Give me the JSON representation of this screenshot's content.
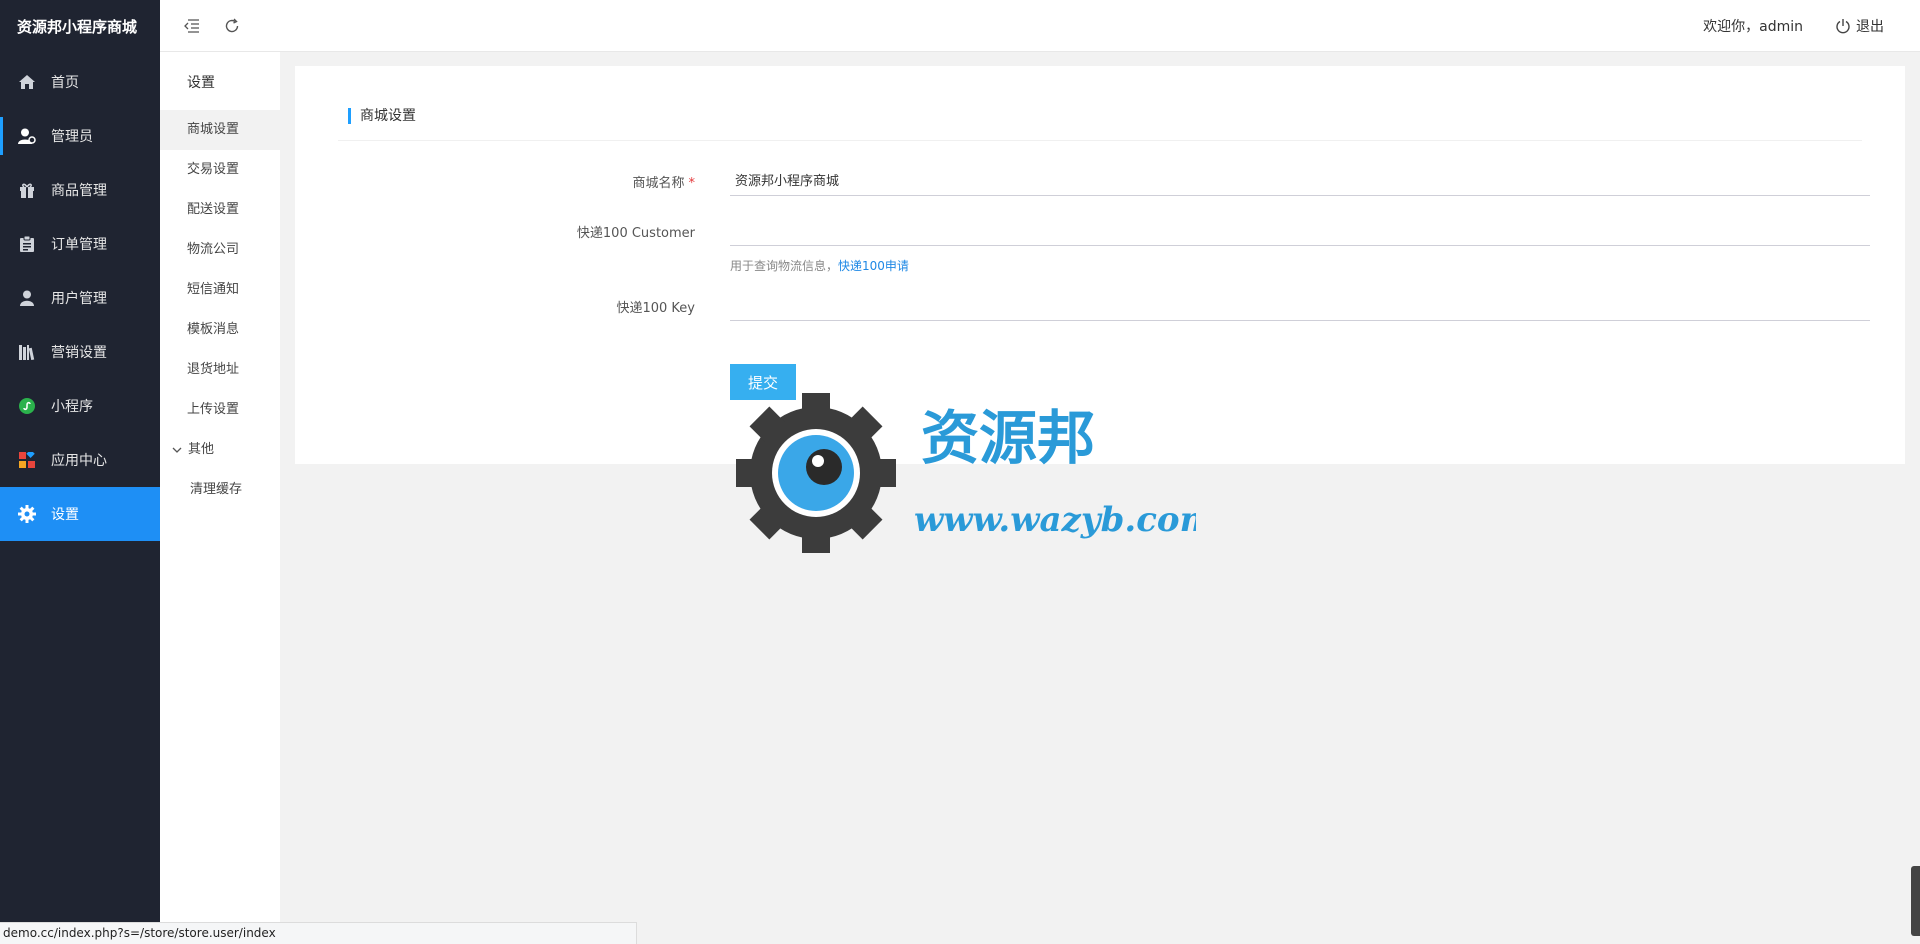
{
  "brand": "资源邦小程序商城",
  "sidebar": {
    "items": [
      {
        "label": "首页",
        "icon": "home-icon"
      },
      {
        "label": "管理员",
        "icon": "admin-user-icon"
      },
      {
        "label": "商品管理",
        "icon": "gift-icon"
      },
      {
        "label": "订单管理",
        "icon": "clipboard-icon"
      },
      {
        "label": "用户管理",
        "icon": "user-icon"
      },
      {
        "label": "营销设置",
        "icon": "books-icon"
      },
      {
        "label": "小程序",
        "icon": "miniprogram-icon"
      },
      {
        "label": "应用中心",
        "icon": "apps-icon"
      },
      {
        "label": "设置",
        "icon": "gear-icon"
      }
    ],
    "active_index": 8,
    "selected_index": 1
  },
  "submenu": {
    "heading": "设置",
    "items": [
      "商城设置",
      "交易设置",
      "配送设置",
      "物流公司",
      "短信通知",
      "模板消息",
      "退货地址",
      "上传设置"
    ],
    "group_label": "其他",
    "group_items": [
      "清理缓存"
    ]
  },
  "topbar": {
    "welcome": "欢迎你，admin",
    "logout": "退出"
  },
  "card": {
    "title": "商城设置",
    "fields": {
      "name_label": "商城名称",
      "name_required": "*",
      "name_value": "资源邦小程序商城",
      "customer_label": "快递100 Customer",
      "customer_value": "",
      "customer_help": "用于查询物流信息，",
      "customer_help_link": "快递100申请",
      "key_label": "快递100 Key",
      "key_value": ""
    },
    "submit": "提交"
  },
  "watermark": {
    "title": "资源邦",
    "url": "www.wazyb.com"
  },
  "statusbar": "demo.cc/index.php?s=/store/store.user/index",
  "colors": {
    "sidebar_bg": "#1f2431",
    "active_blue": "#1e8ff5",
    "accent": "#1e9fff",
    "button": "#36aff0"
  }
}
